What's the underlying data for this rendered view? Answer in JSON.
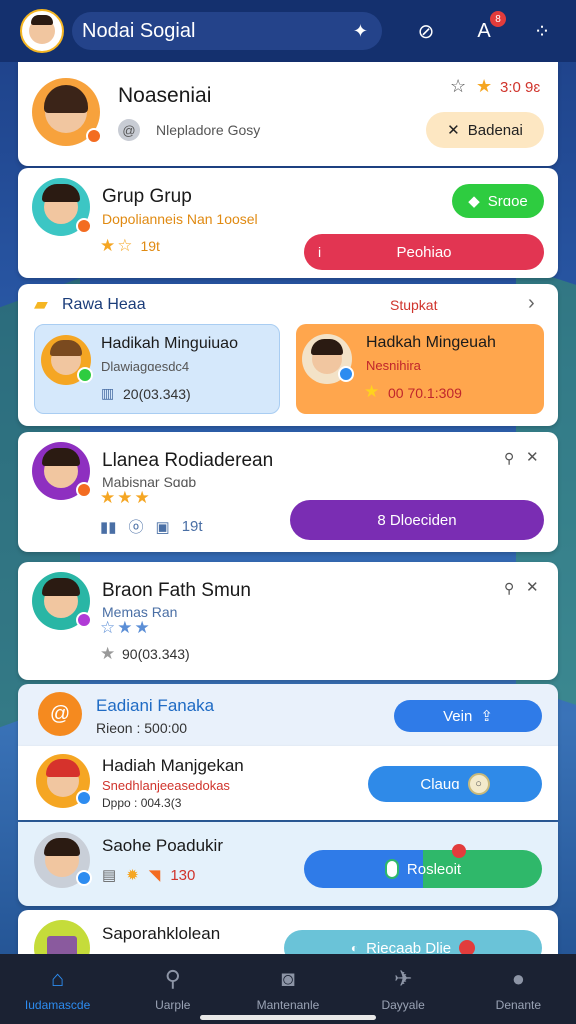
{
  "topbar": {
    "title": "Nodai Sogial",
    "pill_icon": "gift-icon",
    "icons": [
      {
        "name": "compass-icon",
        "glyph": "⊘"
      },
      {
        "name": "translate-icon",
        "glyph": "A",
        "badge": "8"
      },
      {
        "name": "apps-icon",
        "glyph": "⁘"
      }
    ]
  },
  "profile": {
    "name": "Noaseniai",
    "handle": "Nlepladore Gosy",
    "points": "3:0 9ɛ",
    "button_label": "Badenai"
  },
  "group": {
    "name": "Grup Grup",
    "subtitle": "Dopolianneis Nan 1oosel",
    "stars_text": "19t",
    "status_label": "Srɑoe",
    "action_label": "Peohiao"
  },
  "rewards": {
    "title": "Rawa Heaa",
    "link": "Stupkat",
    "tile1": {
      "name": "Hadikah Minguiuao",
      "sub": "Dlawiagɑesdc4",
      "count": "20(03.343)"
    },
    "tile2": {
      "name": "Hadkah Mingeuah",
      "sub": "Nesnihira",
      "count": "00 70.1:309"
    }
  },
  "user1": {
    "name": "Llanea Rodiaderean",
    "sub": "Mabisnar Sɑɑb",
    "stat": "19t",
    "button_label": "8 Dloeciden"
  },
  "user2": {
    "name": "Braon Fath Smun",
    "sub": "Memas Ran",
    "count": "90(03.343)"
  },
  "promo": {
    "title": "Eadiani Fanaka",
    "sub": "Rieon : 500:00",
    "button_label": "Vein"
  },
  "gift": {
    "name": "Hadiah Manjgekan",
    "sub": "Snedhlanjеeasedokas",
    "sub2": "Dppo : 004.3(3",
    "button_label": "Clauɑ"
  },
  "user3": {
    "name": "Saohe Poadukir",
    "stat": "130",
    "button_label": "Rosleoit"
  },
  "user4": {
    "name": "Saporahklolean",
    "button_label": "Riecaab Dlie"
  },
  "nav": [
    {
      "label": "Iudamascde",
      "icon": "home-icon",
      "glyph": "⌂",
      "active": true
    },
    {
      "label": "Uarple",
      "icon": "search-icon",
      "glyph": "⚲",
      "active": false
    },
    {
      "label": "Mantenanle",
      "icon": "camera-icon",
      "glyph": "◙",
      "active": false
    },
    {
      "label": "Dayyale",
      "icon": "messenger-icon",
      "glyph": "✈",
      "active": false
    },
    {
      "label": "Denante",
      "icon": "person-icon",
      "glyph": "●",
      "active": false
    }
  ],
  "colors": {
    "accent": "#2d8cf0",
    "green": "#2ecc40",
    "red": "#e23552",
    "purple": "#7a2db3",
    "orange": "#ffa64d",
    "blue": "#2f7be8"
  }
}
